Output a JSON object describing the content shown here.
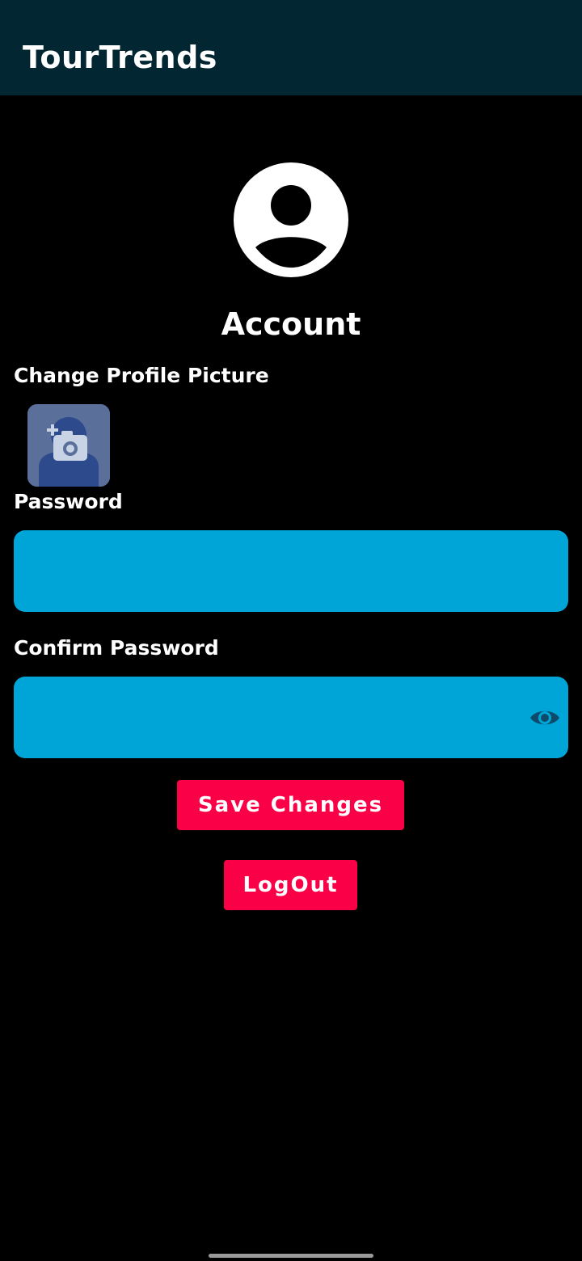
{
  "app": {
    "title": "TourTrends"
  },
  "account": {
    "title": "Account",
    "change_picture_label": "Change Profile Picture",
    "password_label": "Password",
    "password_value": "",
    "confirm_label": "Confirm Password",
    "confirm_value": "",
    "save_label": "Save Changes",
    "logout_label": "LogOut"
  },
  "icons": {
    "avatar": "account-circle-icon",
    "picture": "add-photo-icon",
    "visibility": "eye-icon"
  },
  "colors": {
    "app_bar": "#022732",
    "background": "#000000",
    "field": "#00a5d8",
    "button": "#fa0047",
    "text": "#ffffff"
  }
}
